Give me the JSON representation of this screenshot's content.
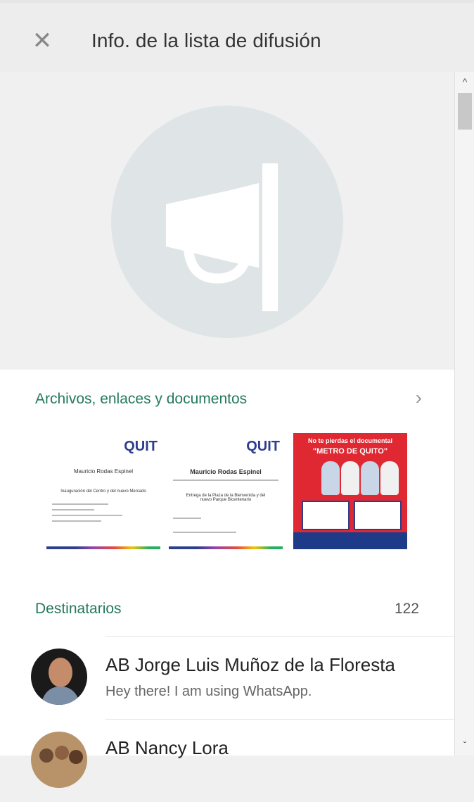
{
  "header": {
    "close_icon": "close-icon",
    "title": "Info. de la lista de difusión"
  },
  "hero": {
    "icon": "megaphone-icon",
    "circle_color": "#dfe5e7"
  },
  "media": {
    "title": "Archivos, enlaces y documentos",
    "arrow_icon": "chevron-right-icon",
    "thumbs": [
      {
        "brand": "QUIT",
        "name": "Mauricio Rodas Espinel",
        "caption": "Inauguración del Centro y del nuevo Mercado"
      },
      {
        "brand": "QUIT",
        "name": "Mauricio Rodas Espinel",
        "caption": "Entrega de la Plaza de la Bienvenida y del nuevo Parque Bicentenario"
      },
      {
        "line1": "No te pierdas el documental",
        "line2": "\"METRO DE QUITO\""
      }
    ]
  },
  "recipients": {
    "title": "Destinatarios",
    "count": "122",
    "items": [
      {
        "name": "AB Jorge Luis Muñoz de la Floresta",
        "status": "Hey there! I am using WhatsApp."
      },
      {
        "name": "AB Nancy Lora",
        "status": ""
      }
    ]
  },
  "scrollbar": {
    "up_icon": "chevron-up-icon",
    "down_icon": "chevron-down-icon"
  },
  "colors": {
    "accent": "#237a5d",
    "header_bg": "#ededed"
  }
}
